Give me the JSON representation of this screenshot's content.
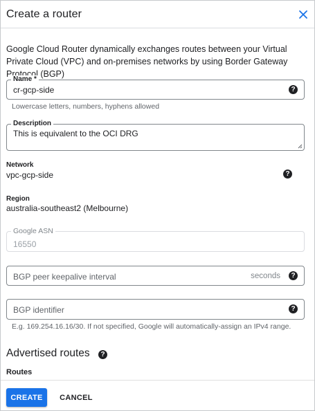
{
  "header": {
    "title": "Create a router"
  },
  "intro": "Google Cloud Router dynamically exchanges routes between your Virtual Private Cloud (VPC) and on-premises networks by using Border Gateway Protocol (BGP)",
  "name_field": {
    "label": "Name *",
    "value": "cr-gcp-side",
    "hint": "Lowercase letters, numbers, hyphens allowed"
  },
  "description_field": {
    "label": "Description",
    "value": "This is equivalent to the OCI DRG"
  },
  "network": {
    "label": "Network",
    "value": "vpc-gcp-side"
  },
  "region": {
    "label": "Region",
    "value": "australia-southeast2 (Melbourne)"
  },
  "asn_field": {
    "label": "Google ASN",
    "value": "16550"
  },
  "keepalive_field": {
    "placeholder": "BGP peer keepalive interval",
    "suffix": "seconds"
  },
  "bgp_identifier_field": {
    "placeholder": "BGP identifier",
    "hint": "E.g. 169.254.16.16/30. If not specified, Google will automatically-assign an IPv4 range."
  },
  "advertised_routes": {
    "heading": "Advertised routes",
    "routes_label": "Routes"
  },
  "footer": {
    "create_label": "CREATE",
    "cancel_label": "CANCEL"
  },
  "icons": {
    "help": "?",
    "close": "close-icon"
  },
  "colors": {
    "primary": "#1a73e8",
    "text": "#202124",
    "muted": "#5f6368"
  }
}
